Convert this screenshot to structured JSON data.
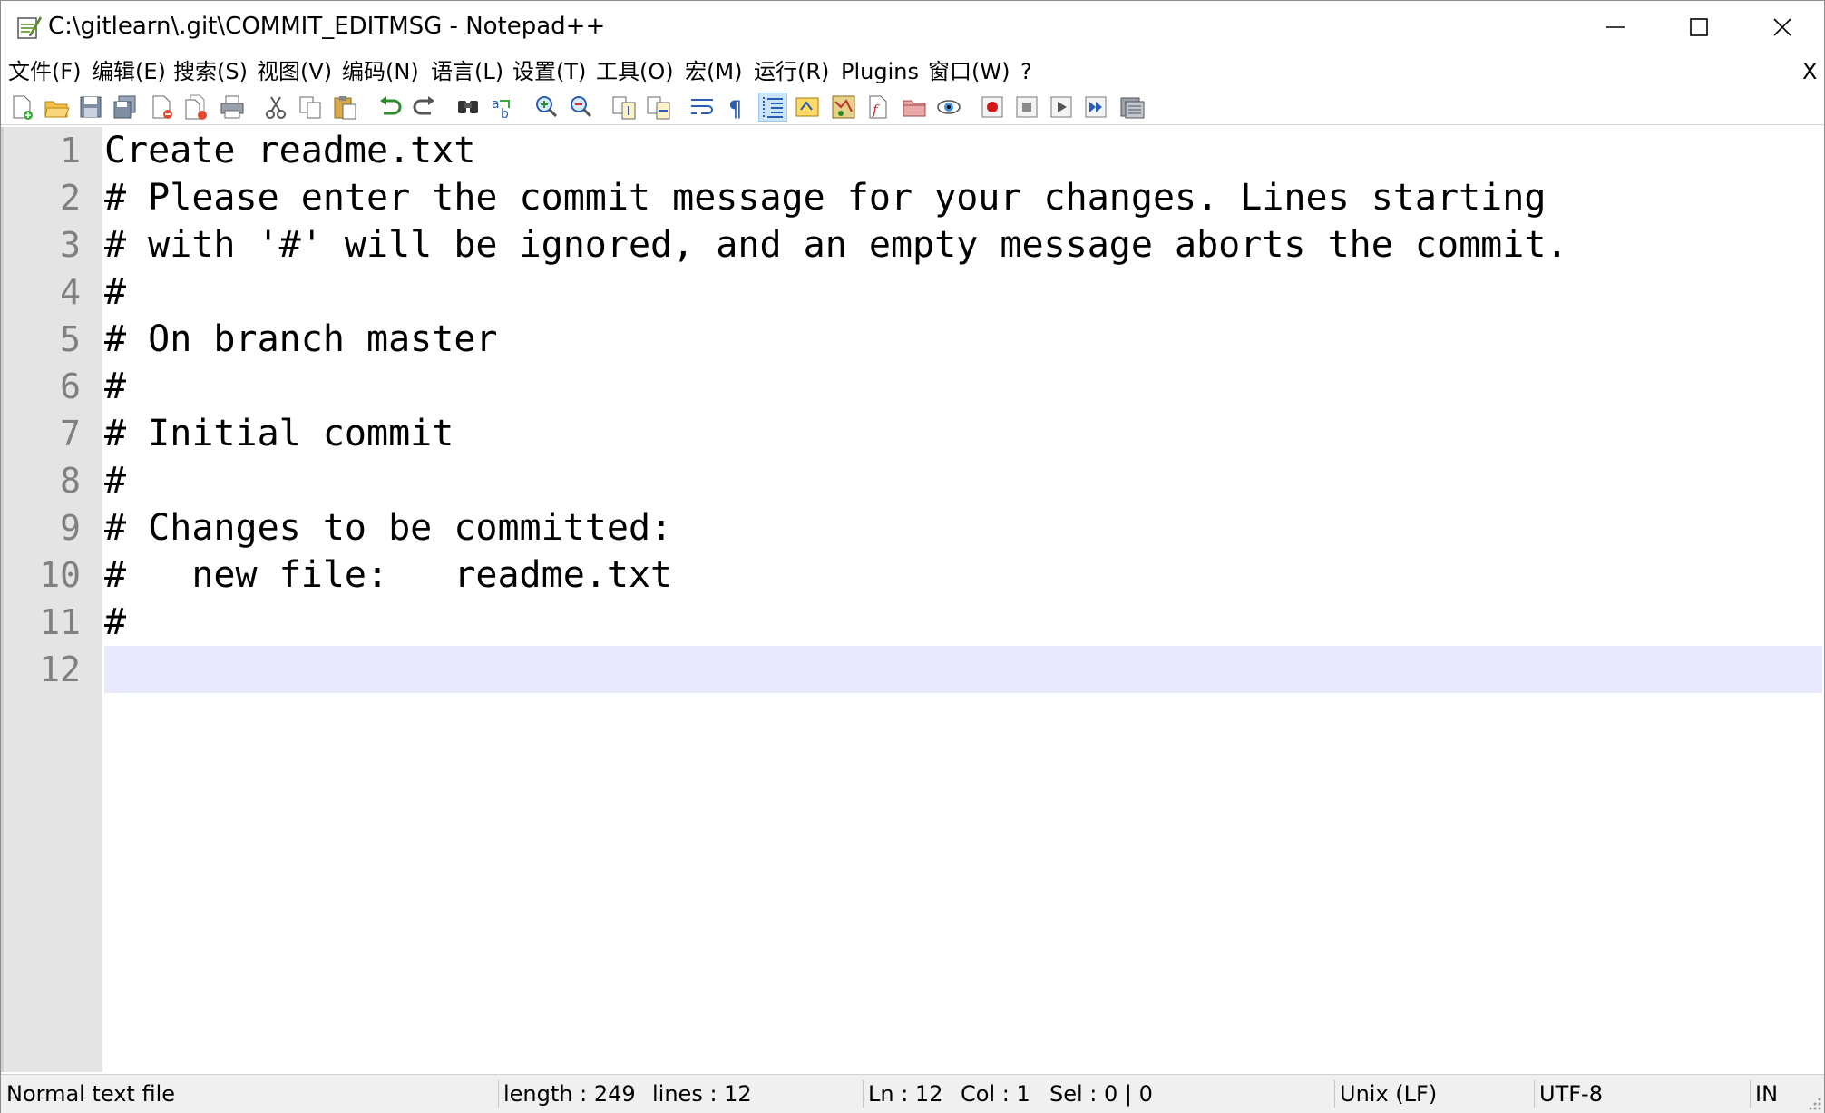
{
  "window": {
    "title": "C:\\gitlearn\\.git\\COMMIT_EDITMSG - Notepad++",
    "minimize_icon": "minimize-icon",
    "maximize_icon": "maximize-icon",
    "close_icon": "close-icon"
  },
  "menu": {
    "items": [
      "文件(F)",
      "编辑(E)",
      "搜索(S)",
      "视图(V)",
      "编码(N)",
      "语言(L)",
      "设置(T)",
      "工具(O)",
      "宏(M)",
      "运行(R)",
      "Plugins",
      "窗口(W)",
      "?"
    ],
    "close_doc": "X"
  },
  "toolbar": {
    "icons": [
      "new-file-icon",
      "open-file-icon",
      "save-icon",
      "save-all-icon",
      "close-icon",
      "close-all-icon",
      "print-icon",
      "cut-icon",
      "copy-icon",
      "paste-icon",
      "undo-icon",
      "redo-icon",
      "find-icon",
      "replace-icon",
      "zoom-in-icon",
      "zoom-out-icon",
      "sync-vertical-icon",
      "sync-horizontal-icon",
      "word-wrap-icon",
      "show-all-chars-icon",
      "indent-guide-icon",
      "user-language-icon",
      "document-map-icon",
      "function-list-icon",
      "folder-workspace-icon",
      "monitoring-icon",
      "record-macro-icon",
      "stop-record-icon",
      "play-macro-icon",
      "run-macro-multiple-icon",
      "save-macro-icon"
    ],
    "active": "indent-guide-icon"
  },
  "editor": {
    "lines": [
      "Create readme.txt",
      "# Please enter the commit message for your changes. Lines starting",
      "# with '#' will be ignored, and an empty message aborts the commit.",
      "#",
      "# On branch master",
      "#",
      "# Initial commit",
      "#",
      "# Changes to be committed:",
      "#\tnew file:   readme.txt",
      "#",
      ""
    ],
    "line_numbers": [
      "1",
      "2",
      "3",
      "4",
      "5",
      "6",
      "7",
      "8",
      "9",
      "10",
      "11",
      "12"
    ],
    "current_line": 12,
    "colors": {
      "gutter": "#e4e4e4",
      "current_line": "#e8e8ff",
      "line_number": "#808080"
    }
  },
  "status": {
    "file_type": "Normal text file",
    "length": "length : 249",
    "lines": "lines : 12",
    "ln": "Ln : 12",
    "col": "Col : 1",
    "sel": "Sel : 0 | 0",
    "eol": "Unix (LF)",
    "encoding": "UTF-8",
    "mode": "IN"
  }
}
